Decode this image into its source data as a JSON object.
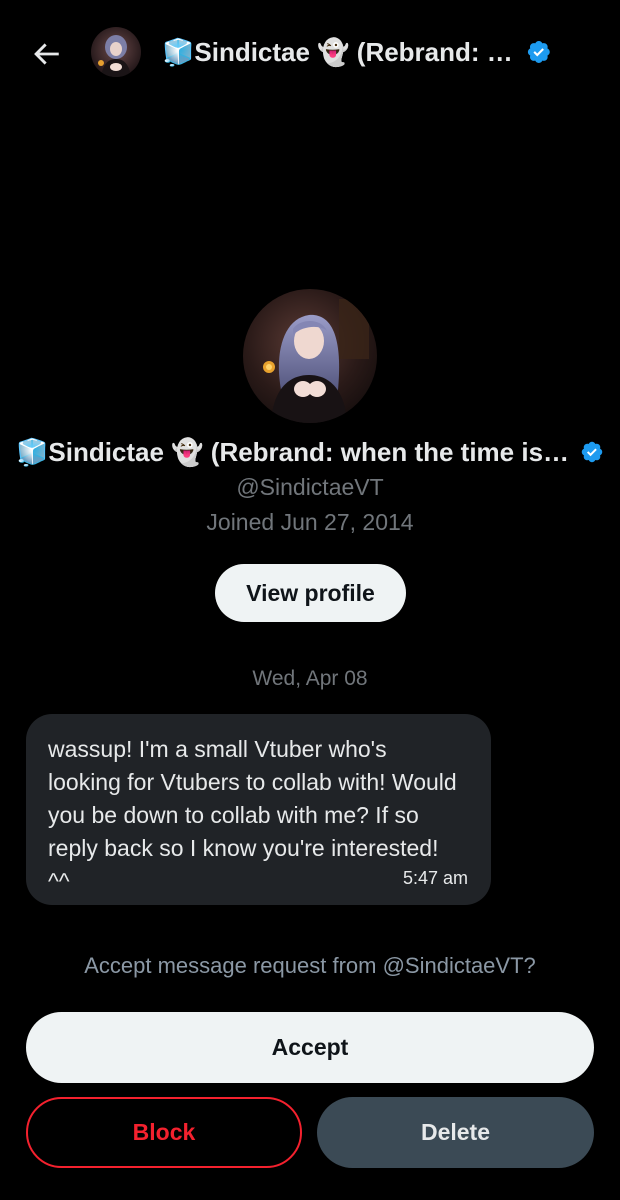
{
  "header": {
    "title": "🧊Sindictae 👻 (Rebrand: w...",
    "back_icon": "arrow-left-icon",
    "verified_icon": "verified-badge-icon"
  },
  "profile": {
    "name": "🧊Sindictae 👻 (Rebrand: when the time is ri...",
    "handle": "@SindictaeVT",
    "joined": "Joined Jun 27, 2014",
    "view_profile_label": "View profile"
  },
  "conversation": {
    "date": "Wed, Apr 08",
    "messages": [
      {
        "text": "wassup! I'm a small Vtuber who's looking for Vtubers to collab with! Would you be down to collab with me? If so reply back so I know you're interested! ^^",
        "time": "5:47 am"
      }
    ]
  },
  "request": {
    "prompt": "Accept message request from @SindictaeVT?",
    "accept_label": "Accept",
    "block_label": "Block",
    "delete_label": "Delete"
  },
  "colors": {
    "background": "#000000",
    "primary_text": "#e7e9ea",
    "secondary_text": "#71767b",
    "verified_blue": "#1d9bf0",
    "danger_red": "#f4212e",
    "bubble": "#202327",
    "delete_button": "#3b4a55",
    "light_button": "#eff3f4"
  }
}
